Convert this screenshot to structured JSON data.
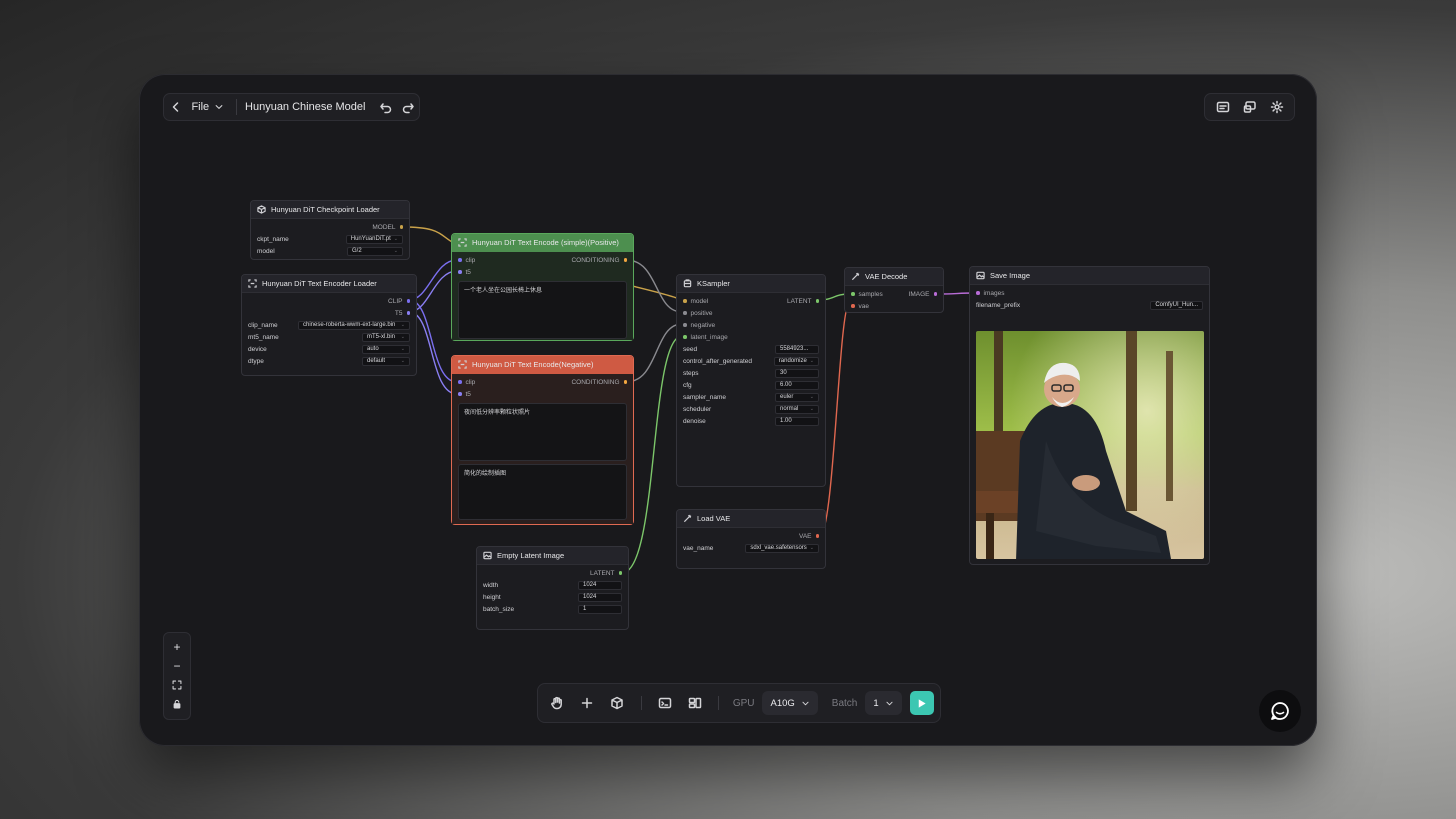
{
  "topbar": {
    "file_label": "File",
    "title": "Hunyuan Chinese Model"
  },
  "icons": {
    "back": "chevron-left-icon",
    "undo": "undo-icon",
    "redo": "redo-icon",
    "panel": "panel-icon",
    "queue": "queue-icon",
    "settings": "gear-icon"
  },
  "nodes": {
    "checkpoint": {
      "title": "Hunyuan DiT Checkpoint Loader",
      "output": "MODEL",
      "ckpt_name_label": "ckpt_name",
      "ckpt_name": "HunYuanDiT.pt",
      "model_label": "model",
      "model": "G/2"
    },
    "encoder_loader": {
      "title": "Hunyuan DiT Text Encoder Loader",
      "out_clip": "CLIP",
      "out_t5": "T5",
      "clip_name_label": "clip_name",
      "clip_name": "chinese-roberta-wwm-ext-large.bin",
      "mt5_name_label": "mt5_name",
      "mt5_name": "mT5-xl.bin",
      "device_label": "device",
      "device": "auto",
      "dtype_label": "dtype",
      "dtype": "default"
    },
    "encode_positive": {
      "title": "Hunyuan DiT Text Encode (simple)(Positive)",
      "in_clip": "clip",
      "in_t5": "t5",
      "output": "CONDITIONING",
      "text": "一个老人坐在公园长椅上休息"
    },
    "encode_negative": {
      "title": "Hunyuan DiT Text Encode(Negative)",
      "in_clip": "clip",
      "in_t5": "t5",
      "output": "CONDITIONING",
      "text": "夜间低分辨率颗粒状照片",
      "text2": "简化的绘制插图"
    },
    "ksampler": {
      "title": "KSampler",
      "output": "LATENT",
      "in_model": "model",
      "in_positive": "positive",
      "in_negative": "negative",
      "in_latent": "latent_image",
      "seed_label": "seed",
      "seed": "5584923...",
      "control_label": "control_after_generated",
      "control": "randomize",
      "steps_label": "steps",
      "steps": "30",
      "cfg_label": "cfg",
      "cfg": "6.00",
      "sampler_label": "sampler_name",
      "sampler": "euler",
      "scheduler_label": "scheduler",
      "scheduler": "normal",
      "denoise_label": "denoise",
      "denoise": "1.00"
    },
    "vae_decode": {
      "title": "VAE Decode",
      "in_samples": "samples",
      "in_vae": "vae",
      "output": "IMAGE"
    },
    "save_image": {
      "title": "Save Image",
      "in_images": "images",
      "prefix_label": "filename_prefix",
      "prefix": "ComfyUI_Hun..."
    },
    "load_vae": {
      "title": "Load VAE",
      "output": "VAE",
      "vae_name_label": "vae_name",
      "vae_name": "sdxl_vae.safetensors"
    },
    "empty_latent": {
      "title": "Empty Latent Image",
      "output": "LATENT",
      "width_label": "width",
      "width": "1024",
      "height_label": "height",
      "height": "1024",
      "batch_label": "batch_size",
      "batch": "1"
    }
  },
  "zoom": {
    "plus": "+",
    "minus": "−"
  },
  "bottombar": {
    "gpu_label": "GPU",
    "gpu_value": "A10G",
    "batch_label": "Batch",
    "batch_value": "1"
  },
  "colors": {
    "accent": "#3cc7b2",
    "positive_header": "#4d8f4f",
    "negative_header": "#cf5a43",
    "wire_model": "#c9a24a",
    "wire_clip": "#7b6ff0",
    "wire_conditioning": "#8a8a8f",
    "wire_latent": "#7cc66a",
    "wire_vae": "#e0674f",
    "wire_image": "#b86cd6"
  }
}
